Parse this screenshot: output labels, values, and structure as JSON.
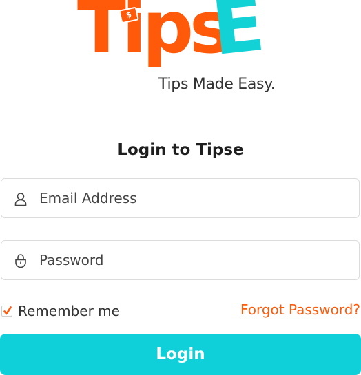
{
  "logo": {
    "word_main": "Tips",
    "word_accent": "E",
    "coin_symbol": "$",
    "tagline": "Tips Made Easy."
  },
  "login": {
    "title": "Login to Tipse",
    "email_placeholder": "Email Address",
    "password_placeholder": "Password",
    "remember_label": "Remember me",
    "remember_checked": true,
    "forgot_label": "Forgot Password?",
    "submit_label": "Login"
  },
  "icons": {
    "email": "user-icon",
    "password": "lock-icon",
    "checkbox": "checkmark-icon"
  },
  "colors": {
    "brand_orange": "#ff5a0a",
    "brand_cyan": "#12d2d6",
    "button": "#0fd0d8"
  }
}
